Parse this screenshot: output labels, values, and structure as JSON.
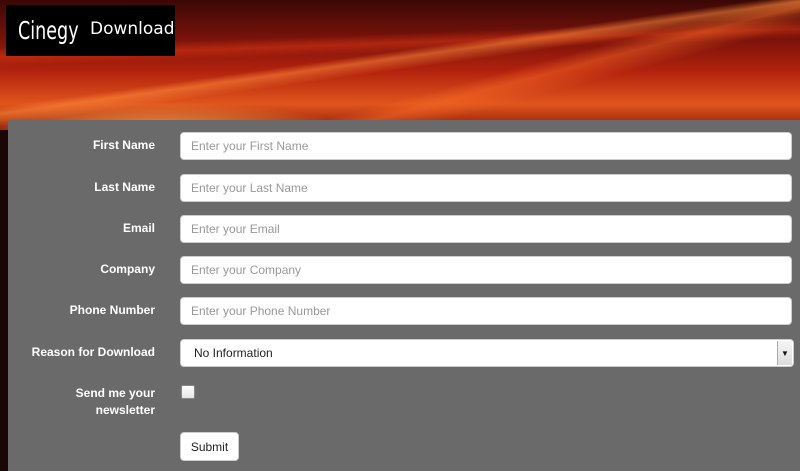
{
  "header": {
    "logo_mark": "Cinegy",
    "title": "Download"
  },
  "form": {
    "first_name": {
      "label": "First Name",
      "placeholder": "Enter your First Name",
      "value": ""
    },
    "last_name": {
      "label": "Last Name",
      "placeholder": "Enter your Last Name",
      "value": ""
    },
    "email": {
      "label": "Email",
      "placeholder": "Enter your Email",
      "value": ""
    },
    "company": {
      "label": "Company",
      "placeholder": "Enter your Company",
      "value": ""
    },
    "phone": {
      "label": "Phone Number",
      "placeholder": "Enter your Phone Number",
      "value": ""
    },
    "reason": {
      "label": "Reason for Download",
      "selected": "No Information"
    },
    "newsletter": {
      "label_line1": "Send me your",
      "label_line2": "newsletter",
      "checked": false
    },
    "submit_label": "Submit"
  },
  "colors": {
    "panel": "#6a6a6a",
    "logo_bg": "#000000",
    "banner_accent": "#e0551c"
  }
}
